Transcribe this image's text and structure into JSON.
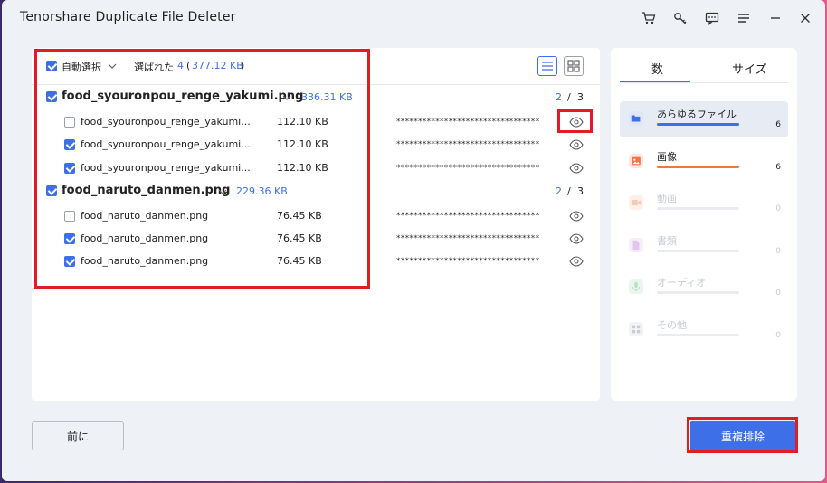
{
  "window": {
    "title": "Tenorshare Duplicate File Deleter"
  },
  "toolbar": {
    "auto_select_label": "自動選択",
    "selected_label": "選ばれた",
    "selected_count": "4",
    "selected_size_open": "(",
    "selected_size": "377.12 KB",
    "selected_size_close": ")"
  },
  "groups": [
    {
      "name": "food_syouronpou_renge_yakumi.png",
      "size": "336.31 KB",
      "ratio_num": "2",
      "ratio_sep": "/",
      "ratio_den": "3",
      "checked": true,
      "files": [
        {
          "name": "food_syouronpou_renge_yakumi....",
          "size": "112.10 KB",
          "hash": "*********************************",
          "checked": false
        },
        {
          "name": "food_syouronpou_renge_yakumi....",
          "size": "112.10 KB",
          "hash": "*********************************",
          "checked": true
        },
        {
          "name": "food_syouronpou_renge_yakumi....",
          "size": "112.10 KB",
          "hash": "*********************************",
          "checked": true
        }
      ]
    },
    {
      "name": "food_naruto_danmen.png",
      "size": "229.36 KB",
      "ratio_num": "2",
      "ratio_sep": "/",
      "ratio_den": "3",
      "checked": true,
      "files": [
        {
          "name": "food_naruto_danmen.png",
          "size": "76.45 KB",
          "hash": "*********************************",
          "checked": false
        },
        {
          "name": "food_naruto_danmen.png",
          "size": "76.45 KB",
          "hash": "*********************************",
          "checked": true
        },
        {
          "name": "food_naruto_danmen.png",
          "size": "76.45 KB",
          "hash": "*********************************",
          "checked": true
        }
      ]
    }
  ],
  "sidebar": {
    "tabs": [
      {
        "label": "数",
        "active": true
      },
      {
        "label": "サイズ",
        "active": false
      }
    ],
    "categories": [
      {
        "label": "あらゆるファイル",
        "count": "6",
        "fill": 1.0,
        "color": "#3d6fe8",
        "icon_bg": "#e1e6f6",
        "icon_fg": "#3d6fe8",
        "icon": "folder-icon"
      },
      {
        "label": "画像",
        "count": "6",
        "fill": 1.0,
        "color": "#f0764a",
        "icon_bg": "#fde6dc",
        "icon_fg": "#f0764a",
        "icon": "image-icon"
      },
      {
        "label": "動画",
        "count": "0",
        "fill": 0,
        "color": "#f6b79d",
        "icon_bg": "#fdf0e9",
        "icon_fg": "#f6c9b5",
        "icon": "video-icon"
      },
      {
        "label": "書類",
        "count": "0",
        "fill": 0,
        "color": "#d9b6e6",
        "icon_bg": "#f8eefb",
        "icon_fg": "#e2c7ec",
        "icon": "document-icon"
      },
      {
        "label": "オーディオ",
        "count": "0",
        "fill": 0,
        "color": "#a8d9b4",
        "icon_bg": "#eaf6ed",
        "icon_fg": "#b8e0c3",
        "icon": "audio-icon"
      },
      {
        "label": "その他",
        "count": "0",
        "fill": 0,
        "color": "#d0d4da",
        "icon_bg": "#f2f3f5",
        "icon_fg": "#c8ccd3",
        "icon": "other-icon"
      }
    ]
  },
  "footer": {
    "back_label": "前に",
    "delete_label": "重複排除"
  },
  "colors": {
    "accent": "#3d6fe8",
    "highlight": "#e11c24"
  }
}
